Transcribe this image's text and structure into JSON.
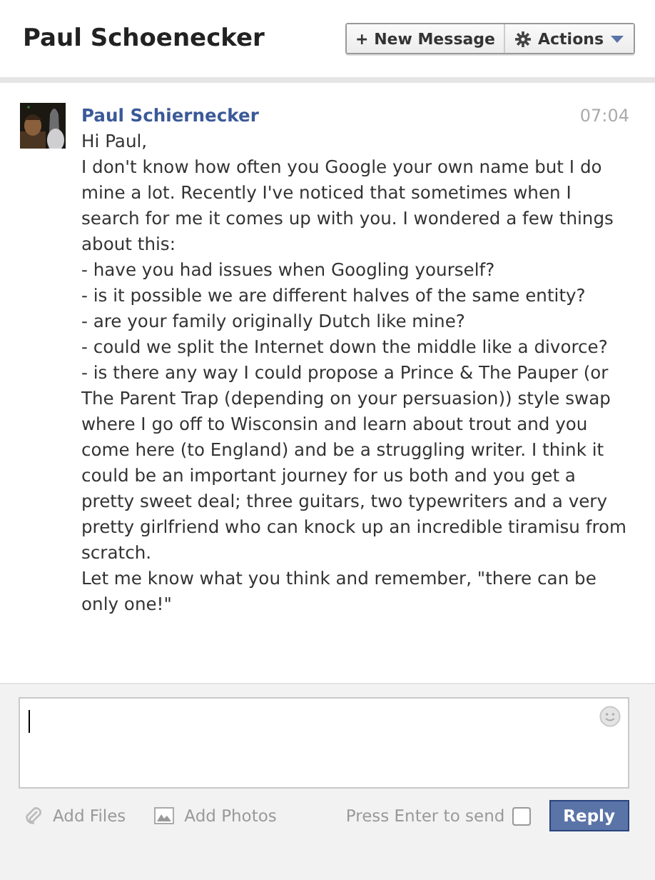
{
  "header": {
    "title": "Paul Schoenecker",
    "new_message": "+ New Message",
    "actions": "Actions"
  },
  "message": {
    "sender": "Paul Schiernecker",
    "time": "07:04",
    "paragraphs": [
      "Hi Paul,",
      "I don't know how often you Google your own name but I do mine a lot. Recently I've noticed that sometimes when I search for me it comes up with you. I wondered a few things about this:",
      "- have you had issues when Googling yourself?",
      "- is it possible we are different halves of the same entity?",
      "- are your family originally Dutch like mine?",
      "- could we split the Internet down the middle like a divorce?",
      "- is there any way I could propose a Prince & The Pauper (or The Parent Trap (depending on your persuasion)) style swap where I go off to Wisconsin and learn about trout and you come here (to England) and be a struggling writer. I think it could be an important journey for us both and you get a pretty sweet deal; three guitars, two typewriters and a very pretty girlfriend who can knock up an incredible tiramisu from scratch.",
      "Let me know what you think and remember, \"there can be only one!\""
    ]
  },
  "composer": {
    "add_files": "Add Files",
    "add_photos": "Add Photos",
    "enter_label": "Press Enter to send",
    "enter_checked": false,
    "reply": "Reply"
  }
}
